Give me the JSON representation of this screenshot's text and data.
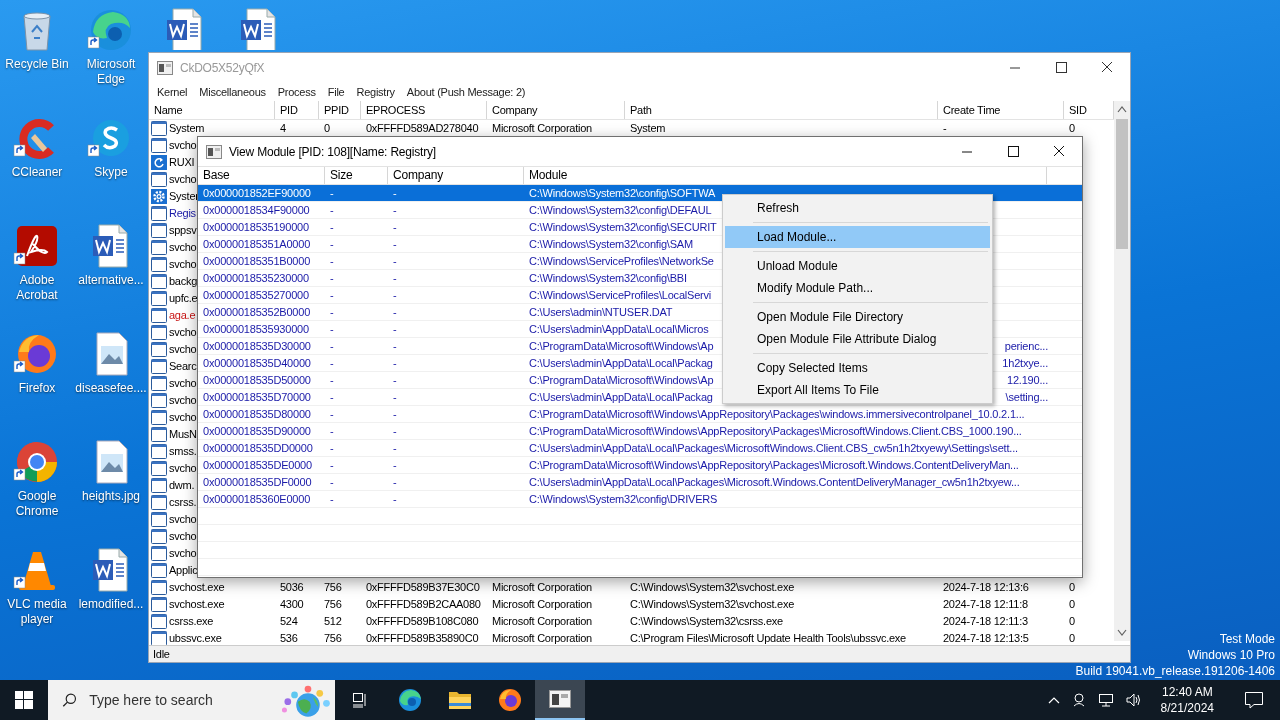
{
  "desktop": {
    "icons": [
      {
        "kind": "recycle",
        "label": "Recycle Bin",
        "shortcut": false
      },
      {
        "kind": "ccleaner",
        "label": "CCleaner",
        "shortcut": true
      },
      {
        "kind": "acrobat",
        "label": "Adobe Acrobat",
        "shortcut": true
      },
      {
        "kind": "firefox",
        "label": "Firefox",
        "shortcut": true
      },
      {
        "kind": "chrome",
        "label": "Google Chrome",
        "shortcut": true
      },
      {
        "kind": "vlc",
        "label": "VLC media player",
        "shortcut": true
      },
      {
        "kind": "edge",
        "label": "Microsoft Edge",
        "shortcut": true
      },
      {
        "kind": "skype",
        "label": "Skype",
        "shortcut": true
      },
      {
        "kind": "word",
        "label": "alternative...",
        "shortcut": false
      },
      {
        "kind": "image",
        "label": "diseasefee....",
        "shortcut": false
      },
      {
        "kind": "image",
        "label": "heights.jpg",
        "shortcut": false
      },
      {
        "kind": "word",
        "label": "lemodified...",
        "shortcut": false
      },
      {
        "kind": "word",
        "shortcut": false
      },
      {
        "kind": "word",
        "shortcut": false
      }
    ],
    "system_watermark": [
      "Test Mode",
      "Windows 10 Pro",
      "Build 19041.vb_release.191206-1406"
    ]
  },
  "main_window": {
    "title": "CkDO5X52yQfX",
    "menu": [
      "Kernel",
      "Miscellaneous",
      "Process",
      "File",
      "Registry",
      "About (Push Message: 2)"
    ],
    "columns": [
      "Name",
      "PID",
      "PPID",
      "EPROCESS",
      "Company",
      "Path",
      "Create Time",
      "SID"
    ],
    "rows": [
      {
        "kind": "window",
        "cells": [
          "System",
          "4",
          "0",
          "0xFFFFD589AD278040",
          "Microsoft Corporation",
          "System",
          "-",
          "0"
        ]
      },
      {
        "kind": "window",
        "cells": [
          "svcho"
        ]
      },
      {
        "kind": "refresh",
        "cells": [
          "RUXI"
        ]
      },
      {
        "kind": "window",
        "cells": [
          "svcho"
        ]
      },
      {
        "kind": "gear",
        "cells": [
          "Syster"
        ]
      },
      {
        "kind": "window",
        "color": "#1a1aa8",
        "cells": [
          "Regis"
        ]
      },
      {
        "kind": "window",
        "cells": [
          "sppsv"
        ]
      },
      {
        "kind": "window",
        "cells": [
          "svcho"
        ]
      },
      {
        "kind": "window",
        "cells": [
          "svcho"
        ]
      },
      {
        "kind": "window",
        "cells": [
          "backg"
        ]
      },
      {
        "kind": "window",
        "cells": [
          "upfc.e"
        ]
      },
      {
        "kind": "window",
        "color": "#c81414",
        "cells": [
          "aga.e"
        ]
      },
      {
        "kind": "window",
        "cells": [
          "svcho"
        ]
      },
      {
        "kind": "window",
        "cells": [
          "svcho"
        ]
      },
      {
        "kind": "window",
        "cells": [
          "Searc"
        ]
      },
      {
        "kind": "window",
        "cells": [
          "svcho"
        ]
      },
      {
        "kind": "window",
        "cells": [
          "svcho"
        ]
      },
      {
        "kind": "window",
        "cells": [
          "svcho"
        ]
      },
      {
        "kind": "window",
        "cells": [
          "MusN"
        ]
      },
      {
        "kind": "window",
        "cells": [
          "smss."
        ]
      },
      {
        "kind": "window",
        "cells": [
          "svcho"
        ]
      },
      {
        "kind": "window",
        "cells": [
          "dwm."
        ]
      },
      {
        "kind": "window",
        "cells": [
          "csrss."
        ]
      },
      {
        "kind": "window",
        "cells": [
          "svcho"
        ]
      },
      {
        "kind": "window",
        "cells": [
          "svcho"
        ]
      },
      {
        "kind": "window",
        "cells": [
          "svcho"
        ]
      },
      {
        "kind": "window",
        "cells": [
          "Applic"
        ]
      },
      {
        "kind": "window",
        "cells": [
          "svchost.exe",
          "5036",
          "756",
          "0xFFFFD589B37E30C0",
          "Microsoft Corporation",
          "C:\\Windows\\System32\\svchost.exe",
          "2024-7-18 12:13:6",
          "0"
        ]
      },
      {
        "kind": "window",
        "cells": [
          "svchost.exe",
          "4300",
          "756",
          "0xFFFFD589B2CAA080",
          "Microsoft Corporation",
          "C:\\Windows\\System32\\svchost.exe",
          "2024-7-18 12:11:8",
          "0"
        ]
      },
      {
        "kind": "window",
        "cells": [
          "csrss.exe",
          "524",
          "512",
          "0xFFFFD589B108C080",
          "Microsoft Corporation",
          "C:\\Windows\\System32\\csrss.exe",
          "2024-7-18 12:11:3",
          "0"
        ]
      },
      {
        "kind": "window",
        "cells": [
          "ubssvc.exe",
          "536",
          "756",
          "0xFFFFD589B35890C0",
          "Microsoft Corporation",
          "C:\\Program Files\\Microsoft Update Health Tools\\ubssvc.exe",
          "2024-7-18 12:13:5",
          "0"
        ]
      }
    ],
    "status": "Idle"
  },
  "module_dialog": {
    "title": "View Module [PID: 108][Name: Registry]",
    "columns": [
      "Base",
      "Size",
      "Company",
      "Module"
    ],
    "rows": [
      {
        "base": "0x000001852EF90000",
        "size": "-",
        "company": "-",
        "module": "C:\\Windows\\System32\\config\\SOFTWA",
        "selected": true
      },
      {
        "base": "0x0000018534F90000",
        "size": "-",
        "company": "-",
        "module": "C:\\Windows\\System32\\config\\DEFAUL",
        "selected": false
      },
      {
        "base": "0x0000018535190000",
        "size": "-",
        "company": "-",
        "module": "C:\\Windows\\System32\\config\\SECURIT",
        "selected": false
      },
      {
        "base": "0x00000185351A0000",
        "size": "-",
        "company": "-",
        "module": "C:\\Windows\\System32\\config\\SAM",
        "selected": false
      },
      {
        "base": "0x00000185351B0000",
        "size": "-",
        "company": "-",
        "module": "C:\\Windows\\ServiceProfiles\\NetworkSe",
        "selected": false
      },
      {
        "base": "0x0000018535230000",
        "size": "-",
        "company": "-",
        "module": "C:\\Windows\\System32\\config\\BBI",
        "selected": false
      },
      {
        "base": "0x0000018535270000",
        "size": "-",
        "company": "-",
        "module": "C:\\Windows\\ServiceProfiles\\LocalServi",
        "selected": false
      },
      {
        "base": "0x00000185352B0000",
        "size": "-",
        "company": "-",
        "module": "C:\\Users\\admin\\NTUSER.DAT",
        "selected": false
      },
      {
        "base": "0x0000018535930000",
        "size": "-",
        "company": "-",
        "module": "C:\\Users\\admin\\AppData\\Local\\Micros",
        "selected": false
      },
      {
        "base": "0x0000018535D30000",
        "size": "-",
        "company": "-",
        "module": "C:\\ProgramData\\Microsoft\\Windows\\Ap",
        "module_end": "perienc...",
        "selected": false
      },
      {
        "base": "0x0000018535D40000",
        "size": "-",
        "company": "-",
        "module": "C:\\Users\\admin\\AppData\\Local\\Packag",
        "module_end": "1h2txye...",
        "selected": false
      },
      {
        "base": "0x0000018535D50000",
        "size": "-",
        "company": "-",
        "module": "C:\\ProgramData\\Microsoft\\Windows\\Ap",
        "module_end": "12.190...",
        "selected": false
      },
      {
        "base": "0x0000018535D70000",
        "size": "-",
        "company": "-",
        "module": "C:\\Users\\admin\\AppData\\Local\\Packag",
        "module_end": "\\setting...",
        "selected": false
      },
      {
        "base": "0x0000018535D80000",
        "size": "-",
        "company": "-",
        "module": "C:\\ProgramData\\Microsoft\\Windows\\AppRepository\\Packages\\windows.immersivecontrolpanel_10.0.2.1...",
        "selected": false
      },
      {
        "base": "0x0000018535D90000",
        "size": "-",
        "company": "-",
        "module": "C:\\ProgramData\\Microsoft\\Windows\\AppRepository\\Packages\\MicrosoftWindows.Client.CBS_1000.190...",
        "selected": false
      },
      {
        "base": "0x0000018535DD0000",
        "size": "-",
        "company": "-",
        "module": "C:\\Users\\admin\\AppData\\Local\\Packages\\MicrosoftWindows.Client.CBS_cw5n1h2txyewy\\Settings\\sett...",
        "selected": false
      },
      {
        "base": "0x0000018535DE0000",
        "size": "-",
        "company": "-",
        "module": "C:\\ProgramData\\Microsoft\\Windows\\AppRepository\\Packages\\Microsoft.Windows.ContentDeliveryMan...",
        "selected": false
      },
      {
        "base": "0x0000018535DF0000",
        "size": "-",
        "company": "-",
        "module": "C:\\Users\\admin\\AppData\\Local\\Packages\\Microsoft.Windows.ContentDeliveryManager_cw5n1h2txyew...",
        "selected": false
      },
      {
        "base": "0x00000185360E0000",
        "size": "-",
        "company": "-",
        "module": "C:\\Windows\\System32\\config\\DRIVERS",
        "selected": false
      }
    ]
  },
  "context_menu": {
    "items": [
      {
        "kind": "item",
        "label": "Refresh",
        "selected": false
      },
      {
        "kind": "separator"
      },
      {
        "kind": "item",
        "label": "Load Module...",
        "selected": true
      },
      {
        "kind": "separator"
      },
      {
        "kind": "item",
        "label": "Unload Module",
        "selected": false
      },
      {
        "kind": "item",
        "label": "Modify Module Path...",
        "selected": false
      },
      {
        "kind": "separator"
      },
      {
        "kind": "item",
        "label": "Open Module File Directory",
        "selected": false
      },
      {
        "kind": "item",
        "label": "Open Module File Attribute Dialog",
        "selected": false
      },
      {
        "kind": "separator"
      },
      {
        "kind": "item",
        "label": "Copy Selected Items",
        "selected": false
      },
      {
        "kind": "item",
        "label": "Export All Items To File",
        "selected": false
      }
    ]
  },
  "taskbar": {
    "search_placeholder": "Type here to search",
    "apps": [
      {
        "kind": "taskview",
        "selected": false
      },
      {
        "kind": "edge",
        "selected": false
      },
      {
        "kind": "folder",
        "selected": false
      },
      {
        "kind": "firefox",
        "selected": false
      },
      {
        "kind": "app",
        "selected": true
      }
    ],
    "time": "12:40 AM",
    "date": "8/21/2024"
  }
}
